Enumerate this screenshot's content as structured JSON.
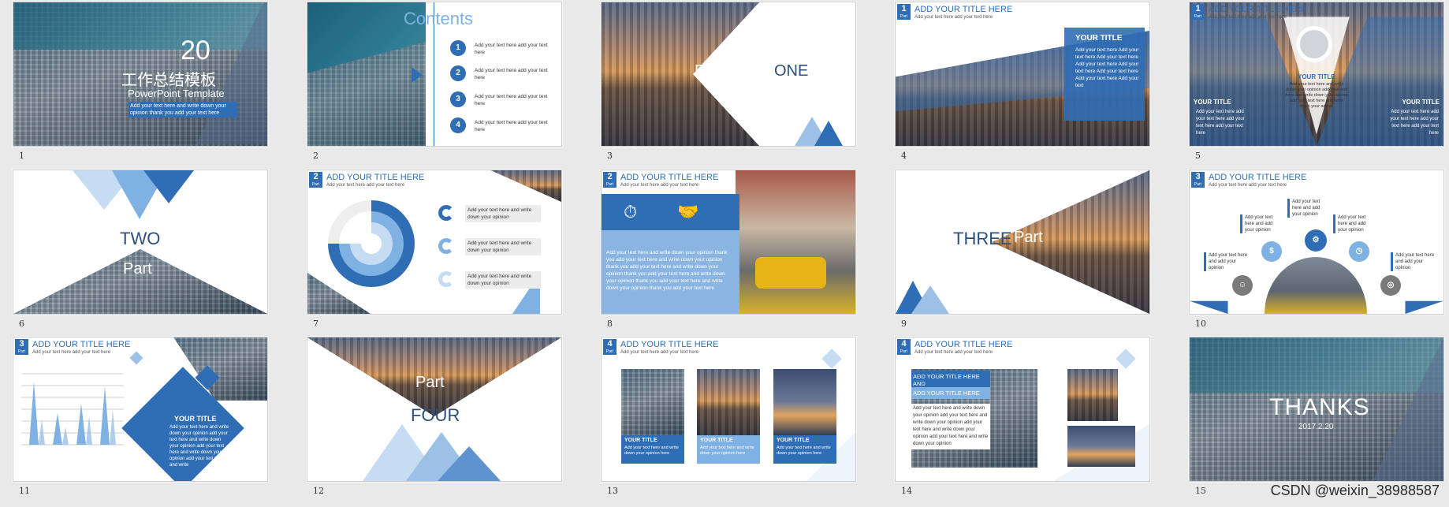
{
  "slides": [
    {
      "n": "1",
      "big": "20",
      "cn": "工作总结模板",
      "en": "PowerPoint Template",
      "desc": "Add your text here and write down your opinion thank you add your text here"
    },
    {
      "n": "2",
      "title": "Contents",
      "items": [
        {
          "k": "1",
          "t": "Add your text here add your text here"
        },
        {
          "k": "2",
          "t": "Add your text here add your text here"
        },
        {
          "k": "3",
          "t": "Add your text here add your text here"
        },
        {
          "k": "4",
          "t": "Add your text here add your text here"
        }
      ]
    },
    {
      "n": "3",
      "part": "Part",
      "word": "ONE"
    },
    {
      "n": "4",
      "badge": "1",
      "title": "ADD YOUR TITLE HERE",
      "sub": "Add your text here add your text here",
      "box_title": "YOUR TITLE",
      "box_text": "Add your text here Add your text here Add your text here Add your text here Add your text here Add your text here Add your text here Add your text"
    },
    {
      "n": "5",
      "badge": "1",
      "title": "ADD YOUR TITLE HERE",
      "sub": "Add your text here add your text here",
      "center_title": "YOUR TITLE",
      "center_text": "Add your text here and write down your opinion add your text here and write down your advise add your text here and write down your advise",
      "left_title": "YOUR TITLE",
      "left_text": "Add your text here add your text here add your text here add your text here",
      "right_title": "YOUR TITLE",
      "right_text": "Add your text here add your text here add your text here add your text here"
    },
    {
      "n": "6",
      "word": "TWO",
      "part": "Part"
    },
    {
      "n": "7",
      "badge": "2",
      "title": "ADD YOUR TITLE HERE",
      "sub": "Add your text here add your text here",
      "items": [
        "Add your text here and write down your opinion",
        "Add your text here and write down your opinion",
        "Add your text here and write down your opinion"
      ]
    },
    {
      "n": "8",
      "badge": "2",
      "title": "ADD YOUR TITLE HERE",
      "sub": "Add your text here add your text here",
      "text": "Add your text here and write down your opinion thank you add your text here and write down your opinion thank you add your text here and write down your opinion thank you add your text here and write down your opinion thank you add your text here and write down your opinion thank you add your text here"
    },
    {
      "n": "9",
      "word": "THREE",
      "part": "Part"
    },
    {
      "n": "10",
      "badge": "3",
      "title": "ADD YOUR TITLE HERE",
      "sub": "Add your text here add your text here",
      "labels": [
        "Add your text here and add your opinion",
        "Add your text here and add your opinion",
        "Add your text here and add your opinion",
        "Add your text here and add your opinion",
        "Add your text here and add your opinion",
        "Add your text here and add your opinion"
      ]
    },
    {
      "n": "11",
      "badge": "3",
      "title": "ADD YOUR TITLE HERE",
      "sub": "Add your text here add your text here",
      "box_title": "YOUR TITLE",
      "box_text": "Add your text here and write down your opinion add your text here and write down your opinion add your text here and write down your opinion add your text here and write"
    },
    {
      "n": "12",
      "part": "Part",
      "word": "FOUR"
    },
    {
      "n": "13",
      "badge": "4",
      "title": "ADD YOUR TITLE HERE",
      "sub": "Add your text here add your text here",
      "cards": [
        {
          "t": "YOUR TITLE",
          "d": "Add your text here and write down your opinion here"
        },
        {
          "t": "YOUR TITLE",
          "d": "Add your text here and write down your opinion here"
        },
        {
          "t": "YOUR TITLE",
          "d": "Add your text here and write down your opinion here"
        }
      ]
    },
    {
      "n": "14",
      "badge": "4",
      "title": "ADD YOUR TITLE HERE",
      "sub": "Add your text here add your text here",
      "bar1": "ADD YOUR TITLE HERE AND",
      "bar2": "ADD YOUR TITLE HERE",
      "text": "Add your text here and write down your opinion add your text here and write down your opinion add your text here and write down your opinion add your text here and write down your opinion"
    },
    {
      "n": "15",
      "title": "THANKS",
      "date": "2017.2.20"
    }
  ],
  "watermark": "CSDN @weixin_38988587"
}
